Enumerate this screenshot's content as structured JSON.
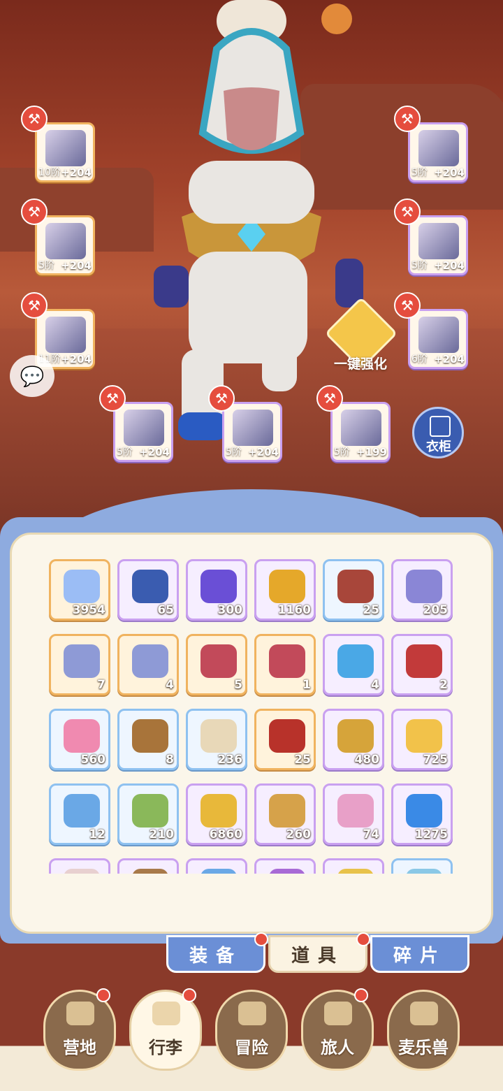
{
  "equipment_slots": [
    {
      "tier": "10阶",
      "bonus": "+204",
      "icon": "sword-icon",
      "rarity": "orange"
    },
    {
      "tier": "5阶",
      "bonus": "+204",
      "icon": "armor-icon",
      "rarity": "orange"
    },
    {
      "tier": "11阶",
      "bonus": "+204",
      "icon": "leg-armor-icon",
      "rarity": "orange"
    },
    {
      "tier": "5阶",
      "bonus": "+204",
      "icon": "helmet-icon",
      "rarity": "purple"
    },
    {
      "tier": "5阶",
      "bonus": "+204",
      "icon": "gauntlet-icon",
      "rarity": "purple"
    },
    {
      "tier": "6阶",
      "bonus": "+204",
      "icon": "boots-icon",
      "rarity": "purple"
    },
    {
      "tier": "5阶",
      "bonus": "+204",
      "icon": "ring-icon",
      "rarity": "purple"
    },
    {
      "tier": "5阶",
      "bonus": "+204",
      "icon": "necklace-icon",
      "rarity": "purple"
    },
    {
      "tier": "5阶",
      "bonus": "+199",
      "icon": "charm-icon",
      "rarity": "purple"
    }
  ],
  "actions": {
    "one_click_enhance": "一键强化",
    "wardrobe": "衣柜"
  },
  "inventory": [
    {
      "qty": "3954",
      "icon": "star-crystal-icon",
      "rarity": "orange",
      "color": "#9bbdf5"
    },
    {
      "qty": "65",
      "icon": "magnet-icon",
      "rarity": "purple",
      "color": "#3a5cb0"
    },
    {
      "qty": "300",
      "icon": "purple-gem-icon",
      "rarity": "purple",
      "color": "#6a4fd6"
    },
    {
      "qty": "1160",
      "icon": "golden-egg-icon",
      "rarity": "purple",
      "color": "#e5a82a"
    },
    {
      "qty": "25",
      "icon": "fur-hat-icon",
      "rarity": "blue",
      "color": "#a8463a"
    },
    {
      "qty": "205",
      "icon": "heart-coin-icon",
      "rarity": "purple",
      "color": "#8a86d6"
    },
    {
      "qty": "7",
      "icon": "blue-crystal-sword-icon",
      "rarity": "orange",
      "color": "#8e9ad6"
    },
    {
      "qty": "4",
      "icon": "blue-crystal-shield-icon",
      "rarity": "orange",
      "color": "#8e9ad6"
    },
    {
      "qty": "5",
      "icon": "red-crystal-sword-icon",
      "rarity": "orange",
      "color": "#c24a5a"
    },
    {
      "qty": "1",
      "icon": "red-crystal-bag-icon",
      "rarity": "orange",
      "color": "#c24a5a"
    },
    {
      "qty": "4",
      "icon": "blue-potion-icon",
      "rarity": "purple",
      "color": "#4aa8e6"
    },
    {
      "qty": "2",
      "icon": "red-potion-icon",
      "rarity": "purple",
      "color": "#c23a3a"
    },
    {
      "qty": "560",
      "icon": "paw-icon",
      "rarity": "blue",
      "color": "#f08ab0"
    },
    {
      "qty": "8",
      "icon": "spoon-icon",
      "rarity": "blue",
      "color": "#a8743a"
    },
    {
      "qty": "236",
      "icon": "rice-bowl-icon",
      "rarity": "blue",
      "color": "#e8d8b8"
    },
    {
      "qty": "25",
      "icon": "card-icon",
      "rarity": "orange",
      "color": "#b8322a"
    },
    {
      "qty": "480",
      "icon": "cat-badge-icon",
      "rarity": "purple",
      "color": "#d6a43a"
    },
    {
      "qty": "725",
      "icon": "cheese-icon",
      "rarity": "purple",
      "color": "#f2c24a"
    },
    {
      "qty": "12",
      "icon": "water-orb-icon",
      "rarity": "blue",
      "color": "#6aa8e6"
    },
    {
      "qty": "210",
      "icon": "herb-paper-icon",
      "rarity": "blue",
      "color": "#8ab85a"
    },
    {
      "qty": "6860",
      "icon": "gold-leaf-icon",
      "rarity": "purple",
      "color": "#e8b83a"
    },
    {
      "qty": "260",
      "icon": "cookie-star-icon",
      "rarity": "purple",
      "color": "#d6a24a"
    },
    {
      "qty": "74",
      "icon": "paint-tube-icon",
      "rarity": "purple",
      "color": "#e8a0c8"
    },
    {
      "qty": "1275",
      "icon": "slime-icon",
      "rarity": "purple",
      "color": "#3a8ae6"
    },
    {
      "qty": "",
      "icon": "item-icon",
      "rarity": "purple",
      "color": "#e8d0d0"
    },
    {
      "qty": "",
      "icon": "item-icon",
      "rarity": "purple",
      "color": "#a87a4a"
    },
    {
      "qty": "",
      "icon": "item-icon",
      "rarity": "purple",
      "color": "#6aa8e6"
    },
    {
      "qty": "",
      "icon": "item-icon",
      "rarity": "purple",
      "color": "#a86ad6"
    },
    {
      "qty": "",
      "icon": "item-icon",
      "rarity": "purple",
      "color": "#e8c24a"
    },
    {
      "qty": "",
      "icon": "item-icon",
      "rarity": "blue",
      "color": "#8ac8e6"
    }
  ],
  "tabs": [
    {
      "label": "装备",
      "active": false,
      "badge": true
    },
    {
      "label": "道具",
      "active": true,
      "badge": true
    },
    {
      "label": "碎片",
      "active": false,
      "badge": false
    }
  ],
  "nav": [
    {
      "label": "营地",
      "icon": "castle-icon",
      "badge": true,
      "active": false
    },
    {
      "label": "行李",
      "icon": "backpack-icon",
      "badge": true,
      "active": true
    },
    {
      "label": "冒险",
      "icon": "crossed-swords-icon",
      "badge": false,
      "active": false
    },
    {
      "label": "旅人",
      "icon": "traveler-icon",
      "badge": true,
      "active": false
    },
    {
      "label": "麦乐兽",
      "icon": "pet-icon",
      "badge": false,
      "active": false
    }
  ]
}
